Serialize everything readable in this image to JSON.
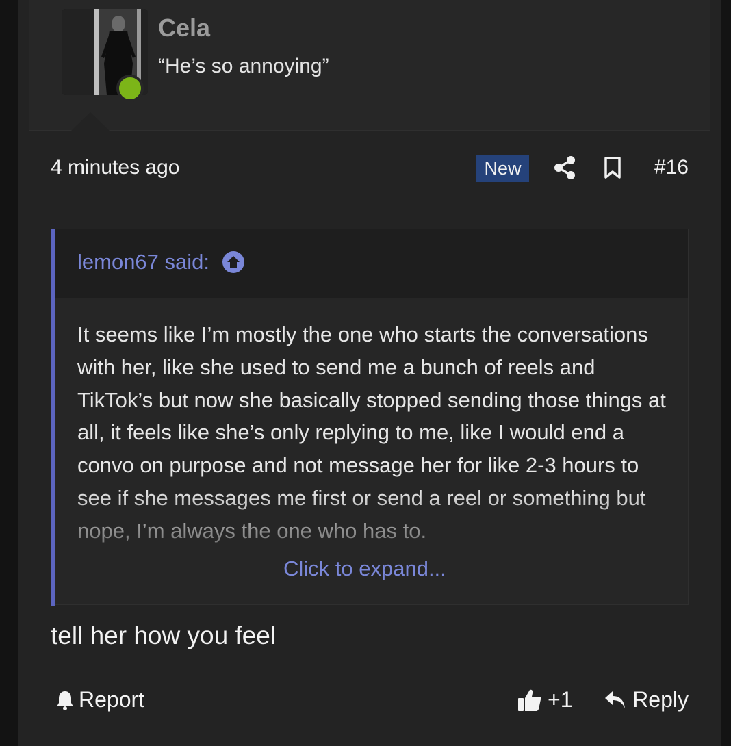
{
  "user": {
    "name": "Cela",
    "title": "“He’s so annoying”",
    "online": true
  },
  "meta": {
    "time": "4 minutes ago",
    "badge": "New",
    "post_number": "#16"
  },
  "quote": {
    "author_label": "lemon67 said:",
    "text": "It seems like I’m mostly the one who starts the conversations with her, like she used to send me a bunch of reels and TikTok’s but now she basically stopped sending those things at all, it feels like she’s only replying to me, like I would end a convo on purpose and not message her for like 2-3 hours to see if she messages me first or send a reel or something but nope, I’m always the one who has to.",
    "expand_label": "Click to expand..."
  },
  "message": "tell her how you feel",
  "footer": {
    "report_label": "Report",
    "like_label": "+1",
    "reply_label": "Reply"
  },
  "colors": {
    "accent": "#7a87d8",
    "quote_bar": "#5c65c0",
    "badge_bg": "#25427a",
    "online": "#7cb518"
  },
  "icons": [
    "share-icon",
    "bookmark-icon",
    "arrow-up-circle-icon",
    "bell-icon",
    "thumbs-up-icon",
    "reply-icon"
  ]
}
